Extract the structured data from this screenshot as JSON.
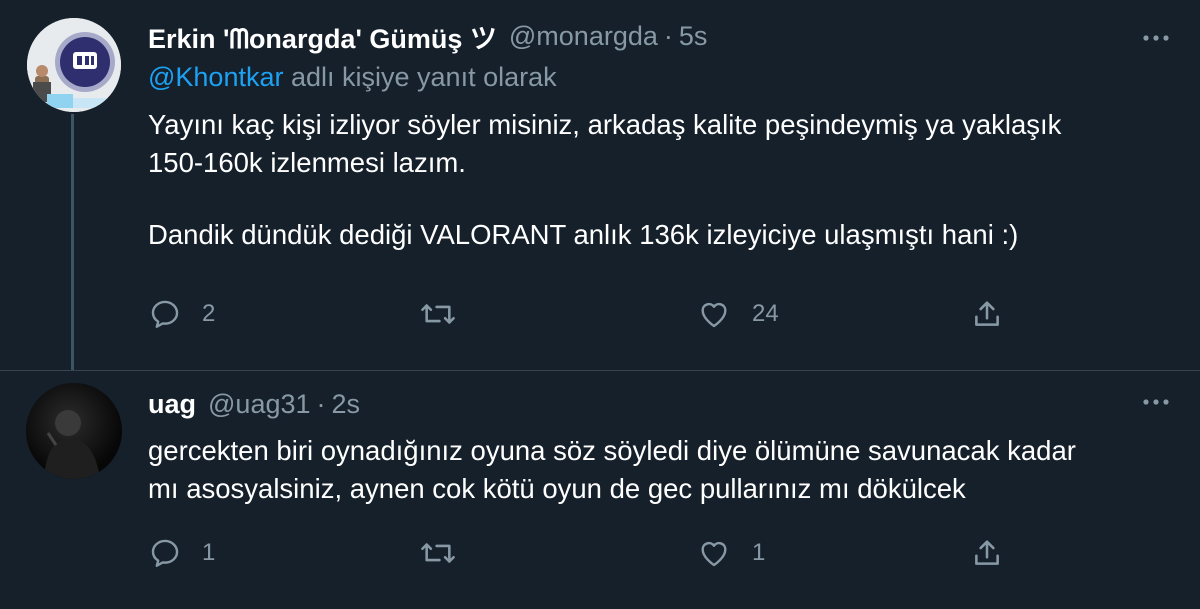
{
  "tweets": [
    {
      "name": "Erkin 'ᗰonargda' Gümüş ツ",
      "handle": "@monargda",
      "separator": "·",
      "time": "5s",
      "reply_to_handle": "@Khontkar",
      "reply_to_suffix": " adlı kişiye yanıt olarak",
      "text_lines": [
        "Yayını kaç kişi izliyor söyler misiniz, arkadaş kalite peşindeymiş ya yaklaşık",
        "150-160k izlenmesi lazım.",
        "Dandik dündük dediği VALORANT anlık 136k izleyiciye ulaşmıştı hani :)"
      ],
      "reply_count": "2",
      "retweet_count": "",
      "like_count": "24"
    },
    {
      "name": "uag",
      "handle": "@uag31",
      "separator": "·",
      "time": "2s",
      "text_lines": [
        "gercekten biri oynadığınız oyuna söz söyledi diye ölümüne savunacak kadar",
        "mı asosyalsiniz, aynen cok kötü oyun de gec pullarınız mı dökülcek"
      ],
      "reply_count": "1",
      "retweet_count": "",
      "like_count": "1"
    }
  ],
  "icons": {
    "more": "more-horizontal-icon",
    "reply": "reply-bubble-icon",
    "retweet": "retweet-icon",
    "like": "heart-icon",
    "share": "share-upload-icon"
  },
  "colors": {
    "background": "#15202b",
    "text": "#ffffff",
    "muted": "#8899a6",
    "link": "#1da1f2",
    "divider": "#38444d",
    "thread_line": "#3d5466"
  }
}
